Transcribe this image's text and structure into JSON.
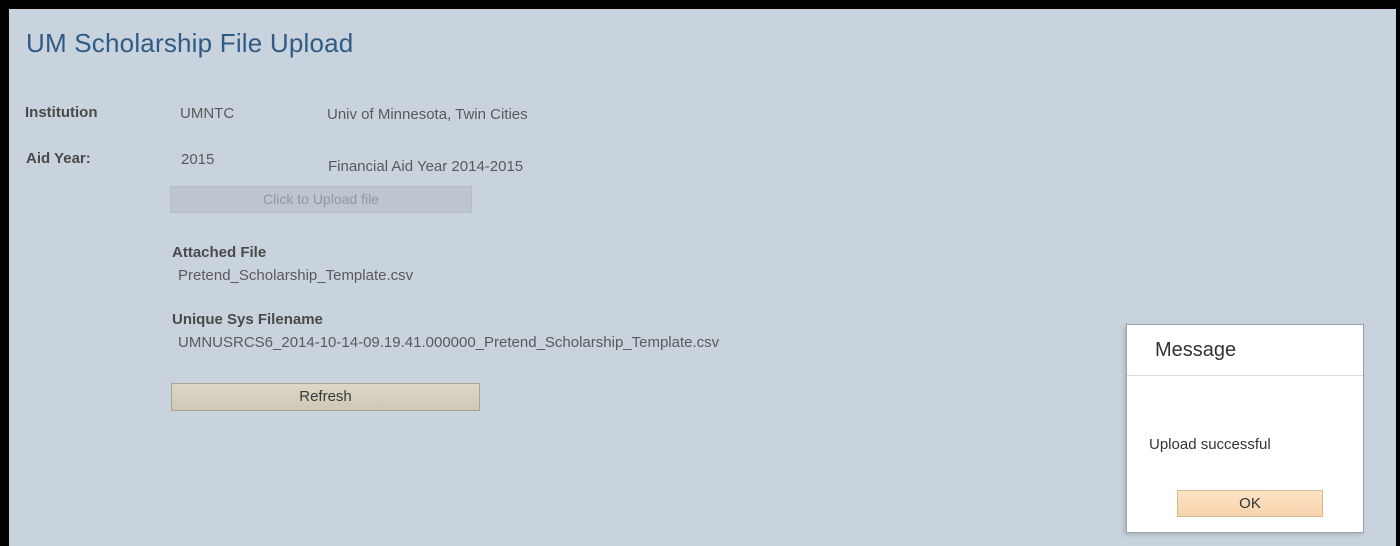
{
  "page": {
    "title": "UM Scholarship File Upload"
  },
  "fields": {
    "institution": {
      "label": "Institution",
      "code": "UMNTC",
      "description": "Univ of Minnesota, Twin Cities"
    },
    "aid_year": {
      "label": "Aid Year:",
      "code": "2015",
      "description": "Financial Aid Year 2014-2015"
    }
  },
  "upload": {
    "button_label": "Click to Upload file",
    "state": "disabled"
  },
  "attached_file": {
    "label": "Attached File",
    "value": "Pretend_Scholarship_Template.csv"
  },
  "unique_sys_filename": {
    "label": "Unique Sys Filename",
    "value": "UMNUSRCS6_2014-10-14-09.19.41.000000_Pretend_Scholarship_Template.csv"
  },
  "refresh": {
    "button_label": "Refresh"
  },
  "message_dialog": {
    "title": "Message",
    "text": "Upload successful",
    "ok_label": "OK"
  },
  "colors": {
    "page_background": "#c9d3dd",
    "title": "#2f5b86",
    "ok_button": "#f6d3aa",
    "refresh_button": "#cfc8b6"
  }
}
